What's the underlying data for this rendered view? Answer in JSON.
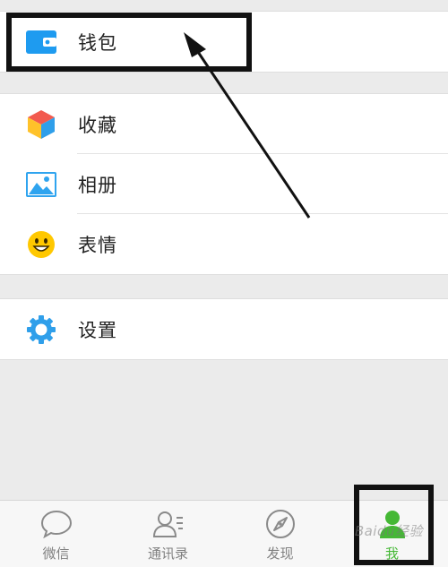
{
  "menu": {
    "wallet": {
      "label": "钱包",
      "icon": "wallet-icon"
    },
    "favorites": {
      "label": "收藏",
      "icon": "cube-icon"
    },
    "album": {
      "label": "相册",
      "icon": "picture-icon"
    },
    "stickers": {
      "label": "表情",
      "icon": "smiley-icon"
    },
    "settings": {
      "label": "设置",
      "icon": "gear-icon"
    }
  },
  "tabbar": {
    "tabs": [
      {
        "label": "微信",
        "icon": "chat-bubble-icon",
        "active": false
      },
      {
        "label": "通讯录",
        "icon": "contacts-icon",
        "active": false
      },
      {
        "label": "发现",
        "icon": "compass-icon",
        "active": false
      },
      {
        "label": "我",
        "icon": "person-icon",
        "active": true
      }
    ]
  },
  "watermark": "Baidu经验",
  "colors": {
    "active_tab": "#45b835",
    "wallet_blue": "#1e9bf0",
    "settings_blue": "#2f9fea",
    "smiley_yellow": "#ffc800",
    "annotation": "#111111"
  }
}
